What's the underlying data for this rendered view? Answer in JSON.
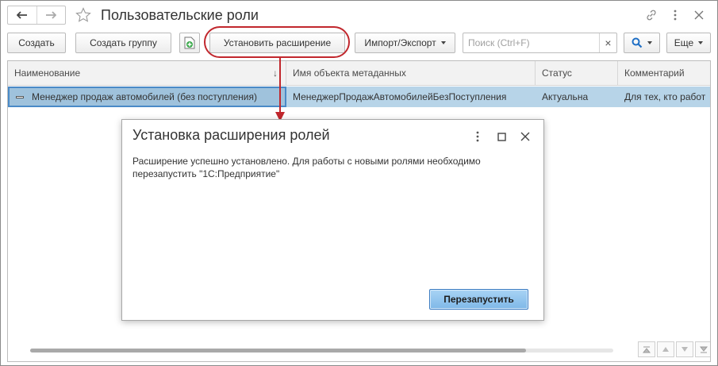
{
  "window": {
    "title": "Пользовательские роли"
  },
  "toolbar": {
    "create_label": "Создать",
    "create_group_label": "Создать группу",
    "install_extension_label": "Установить расширение",
    "import_export_label": "Импорт/Экспорт",
    "search_placeholder": "Поиск (Ctrl+F)",
    "search_clear": "×",
    "more_label": "Еще"
  },
  "table": {
    "columns": [
      "Наименование",
      "Имя объекта метаданных",
      "Статус",
      "Комментарий"
    ],
    "sort_indicator": "↓",
    "rows": [
      {
        "name": "Менеджер продаж автомобилей (без поступления)",
        "metadata_object": "МенеджерПродажАвтомобилейБезПоступления",
        "status": "Актуальна",
        "comment": "Для тех, кто работ"
      }
    ]
  },
  "dialog": {
    "title": "Установка расширения ролей",
    "message": "Расширение успешно установлено. Для работы с новыми ролями необходимо перезапустить \"1С:Предприятие\"",
    "restart_label": "Перезапустить"
  },
  "colors": {
    "selected_row": "#b7d4e8",
    "highlight_red": "#c1272d",
    "primary_button": "#7fb8e8"
  }
}
